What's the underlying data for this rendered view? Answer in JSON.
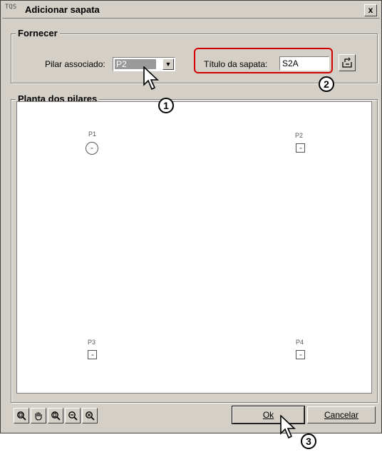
{
  "window": {
    "title": "Adicionar sapata",
    "app_icon_text": "TQS",
    "close_label": "x"
  },
  "fornecer": {
    "group_label": "Fornecer",
    "pilar_label": "Pilar associado:",
    "pilar_value": "P2",
    "titulo_label": "Título da sapata:",
    "titulo_value": "S2A"
  },
  "planta": {
    "group_label": "Planta dos pilares",
    "pillars": [
      {
        "label": "P1",
        "shape": "circle"
      },
      {
        "label": "P2",
        "shape": "square"
      },
      {
        "label": "P3",
        "shape": "square"
      },
      {
        "label": "P4",
        "shape": "square"
      }
    ]
  },
  "toolbar": {
    "icons": [
      "zoom-window-icon",
      "pan-hand-icon",
      "zoom-all-icon",
      "zoom-out-icon",
      "zoom-previous-icon"
    ]
  },
  "buttons": {
    "ok_label": "Ok",
    "cancel_label": "Cancelar"
  },
  "callouts": [
    "1",
    "2",
    "3"
  ],
  "colors": {
    "dialog_bg": "#d4d0c8",
    "highlight_red": "#d40000",
    "canvas_bg": "#ffffff"
  }
}
